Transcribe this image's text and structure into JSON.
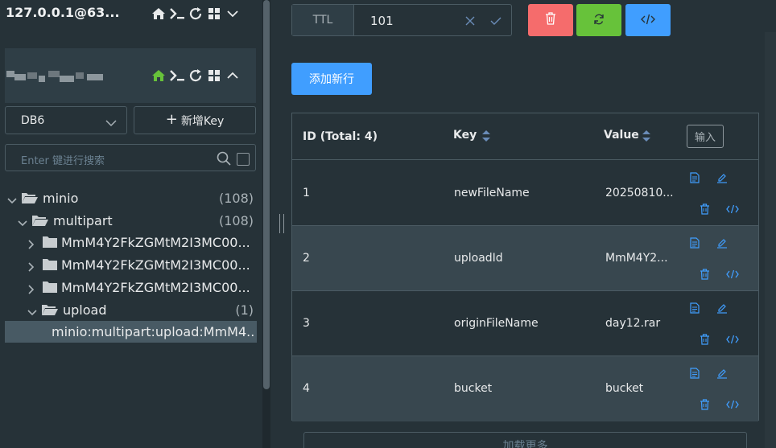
{
  "connections": [
    {
      "name": "127.0.0.1@63...",
      "expanded": false
    },
    {
      "name": "",
      "expanded": true
    }
  ],
  "sidebar": {
    "db_selected": "DB6",
    "new_key_label": "新增Key",
    "search_placeholder": "Enter 键进行搜索",
    "tree": [
      {
        "label": "minio",
        "count": "(108)",
        "level": 0,
        "open": true,
        "type": "folder"
      },
      {
        "label": "multipart",
        "count": "(108)",
        "level": 1,
        "open": true,
        "type": "folder"
      },
      {
        "label": "MmM4Y2FkZGMtM2I3MC00...",
        "count": "",
        "level": 2,
        "open": false,
        "type": "folder"
      },
      {
        "label": "MmM4Y2FkZGMtM2I3MC00...",
        "count": "",
        "level": 2,
        "open": false,
        "type": "folder"
      },
      {
        "label": "MmM4Y2FkZGMtM2I3MC00...",
        "count": "",
        "level": 2,
        "open": false,
        "type": "folder"
      },
      {
        "label": "upload",
        "count": "(1)",
        "level": 2,
        "open": true,
        "type": "folder"
      },
      {
        "label": "minio:multipart:upload:MmM4...",
        "count": "",
        "level": 3,
        "type": "key",
        "selected": true
      }
    ]
  },
  "key_view": {
    "ttl_label": "TTL",
    "ttl_value": "101",
    "add_row_label": "添加新行",
    "table": {
      "col_id": "ID (Total: 4)",
      "col_key": "Key",
      "col_value": "Value",
      "input_btn": "输入",
      "rows": [
        {
          "id": "1",
          "key": "newFileName",
          "value": "20250810..."
        },
        {
          "id": "2",
          "key": "uploadId",
          "value": "MmM4Y2..."
        },
        {
          "id": "3",
          "key": "originFileName",
          "value": "day12.rar"
        },
        {
          "id": "4",
          "key": "bucket",
          "value": "bucket"
        }
      ]
    },
    "load_more_label": "加载更多"
  },
  "colors": {
    "bg": "#263238",
    "danger": "#f56c6c",
    "success": "#67c23a",
    "primary": "#409eff",
    "home_active": "#67c23a"
  }
}
